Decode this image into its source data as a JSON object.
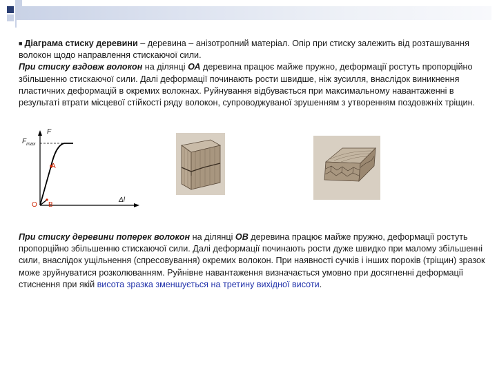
{
  "header": {
    "colors": {
      "square_dark": "#2b3f73",
      "square_light": "#c9d2e6",
      "bar": "#c9d2e6"
    }
  },
  "para1": {
    "bullet": "■",
    "title": "Діаграма стиску деревини",
    "intro": " – деревина – анізотропний матеріал. Опір при стиску залежить від розташування волокон щодо направлення стискаючої сили.",
    "subtitle": "При стиску вздовж волокон",
    "t1": " на ділянці ",
    "seg": "ОА",
    "t2": " деревина працює майже пружно, деформації ростуть пропорційно збільшенню стискаючої сили. Далі деформації починають рости швидше, ніж зусилля, внаслідок виникнення пластичних деформацій в окремих волокнах. Руйнування відбувається при максимальному навантаженні в результаті втрати місцевої стійкості ряду волокон, супроводжуваної зрушенням з утворенням поздовжніх тріщин."
  },
  "diagram": {
    "F": "F",
    "Fmax": "F",
    "Fmax_sub": "max",
    "A": "A",
    "O": "O",
    "B": "B",
    "dl": "Δl",
    "colors": {
      "axis": "#000000",
      "curve": "#000000",
      "marker": "#cc2200"
    }
  },
  "para2": {
    "subtitle": "При стиску деревини поперек волокон",
    "t1": " на ділянці ",
    "seg": "ОВ",
    "t2": " деревина працює майже пружно, деформації ростуть пропорційно збільшенню стискаючої сили. Далі деформації починають рости дуже швидко при малому збільшенні сили, внаслідок ущільнення (спресовування) окремих волокон. При наявності сучків і інших пороків (тріщин) зразок може зруйнуватися розколюванням. Руйнівне навантаження визначається умовно при досягненні деформації стиснення при якій ",
    "t3": "висота зразка зменшується на третину вихідної висоти",
    "t4": "."
  }
}
